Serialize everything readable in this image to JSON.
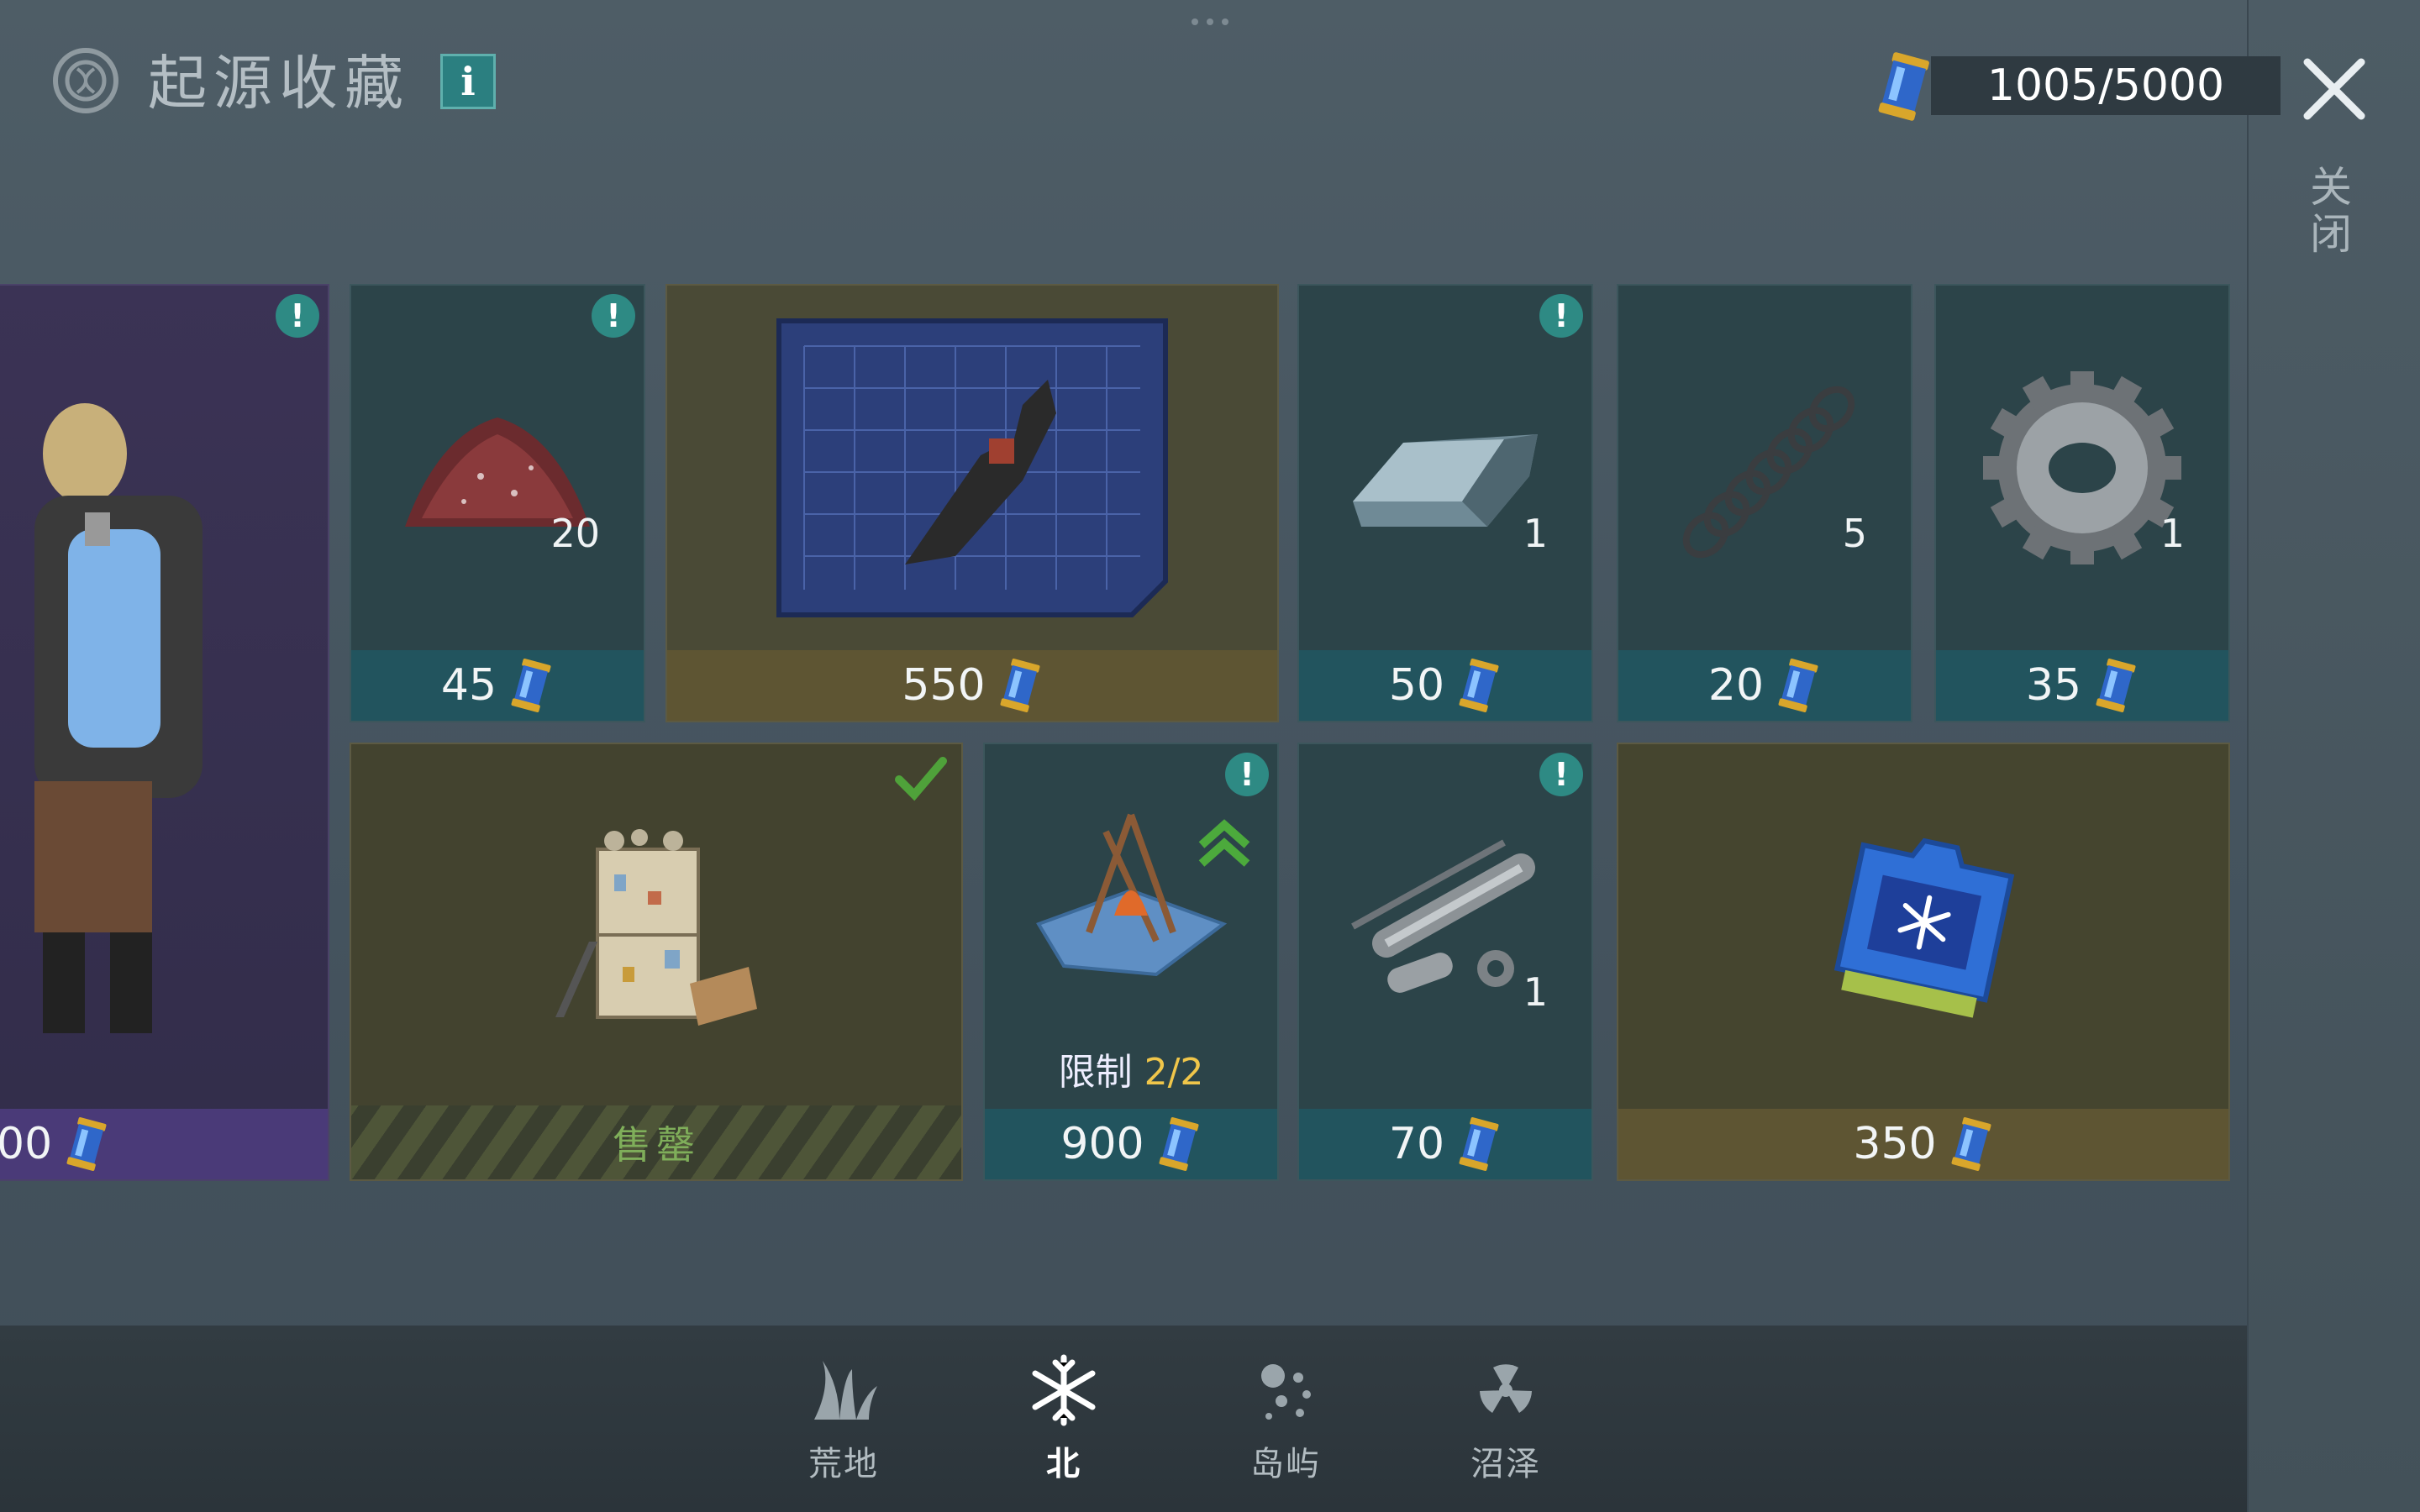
{
  "header": {
    "title": "起源收藏",
    "info_label": "i",
    "currency": "1005/5000",
    "close_label": "关闭"
  },
  "cards": {
    "partial_suit": {
      "price": "00"
    },
    "gunpowder": {
      "qty": "20",
      "price": "45"
    },
    "blueprint": {
      "price": "550"
    },
    "steel_bar": {
      "qty": "1",
      "price": "50"
    },
    "spring": {
      "qty": "5",
      "price": "20"
    },
    "gear": {
      "qty": "1",
      "price": "35"
    },
    "workbench_set": {
      "status": "售罄"
    },
    "campfire": {
      "limit_label": "限制",
      "limit_value": "2/2",
      "price": "900"
    },
    "pipe_parts": {
      "qty": "1",
      "price": "70"
    },
    "chip": {
      "price": "350"
    }
  },
  "nav": {
    "items": [
      {
        "label": "荒地",
        "icon": "grass-icon"
      },
      {
        "label": "北",
        "icon": "snowflake-icon",
        "active": true
      },
      {
        "label": "岛屿",
        "icon": "island-icon"
      },
      {
        "label": "沼泽",
        "icon": "radiation-icon"
      }
    ]
  },
  "colors": {
    "accent_teal": "#2e8a84",
    "limit_highlight": "#f0c64a",
    "soldout_green": "#7fae5a"
  }
}
